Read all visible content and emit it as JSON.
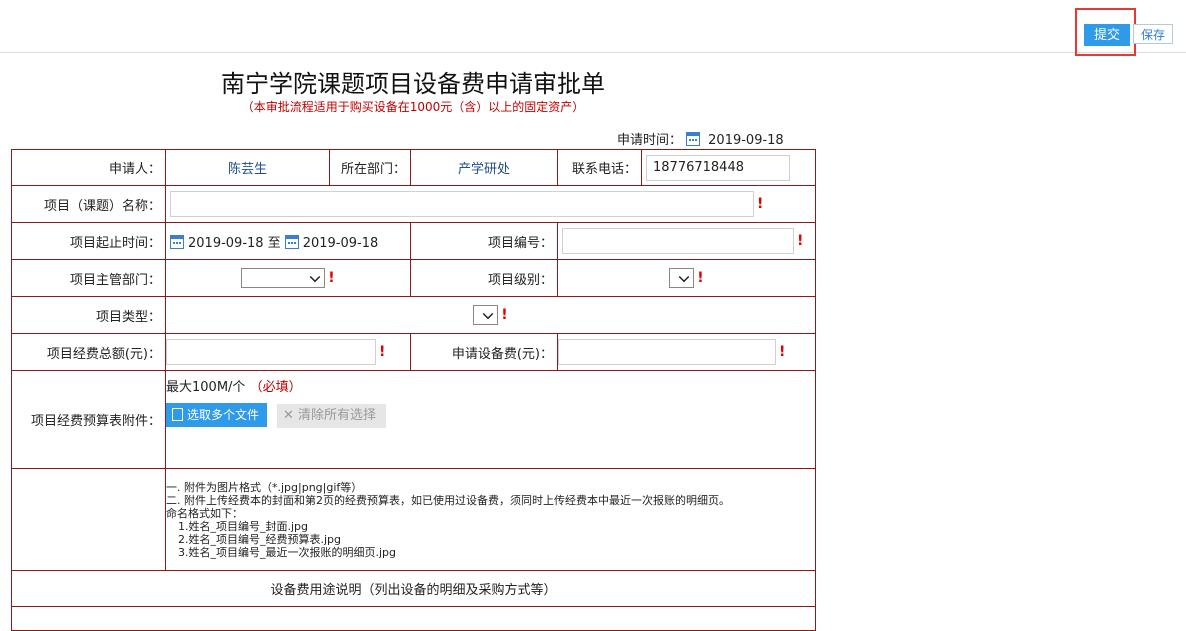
{
  "toolbar": {
    "submit_label": "提交",
    "save_label": "保存"
  },
  "form": {
    "title": "南宁学院课题项目设备费申请审批单",
    "subtitle": "（本审批流程适用于购买设备在1000元（含）以上的固定资产）",
    "apply_time_label": "申请时间：",
    "apply_time": "2019-09-18",
    "applicant_label": "申请人：",
    "applicant": "陈芸生",
    "dept_label": "所在部门：",
    "dept": "产学研处",
    "phone_label": "联系电话：",
    "phone": "18776718448",
    "project_name_label": "项目（课题）名称：",
    "project_period_label": "项目起止时间：",
    "start_date": "2019-09-18",
    "to_text": "至",
    "end_date": "2019-09-18",
    "project_no_label": "项目编号：",
    "supervisor_label": "项目主管部门：",
    "level_label": "项目级别：",
    "type_label": "项目类型：",
    "total_budget_label": "项目经费总额(元)：",
    "equipment_fee_label": "申请设备费(元)：",
    "attachment_label": "项目经费预算表附件：",
    "max_size": "最大100M/个",
    "required_text": "（必填）",
    "upload_label": "选取多个文件",
    "clear_label": "清除所有选择",
    "required_mark": "!",
    "notes": [
      "一. 附件为图片格式（*.jpg|png|gif等）",
      "二. 附件上传经费本的封面和第2页的经费预算表，如已使用过设备费，须同时上传经费本中最近一次报账的明细页。",
      "命名格式如下：",
      "1.姓名_项目编号_封面.jpg",
      "2.姓名_项目编号_经费预算表.jpg",
      "3.姓名_项目编号_最近一次报账的明细页.jpg"
    ],
    "usage_label": "设备费用途说明（列出设备的明细及采购方式等）"
  },
  "colors": {
    "accent": "#2f9be8",
    "border": "#8b1a1a",
    "required": "#e00000",
    "highlight": "#e53935"
  },
  "icons": [
    "calendar-icon",
    "file-icon",
    "close-icon",
    "chevron-down-icon"
  ]
}
